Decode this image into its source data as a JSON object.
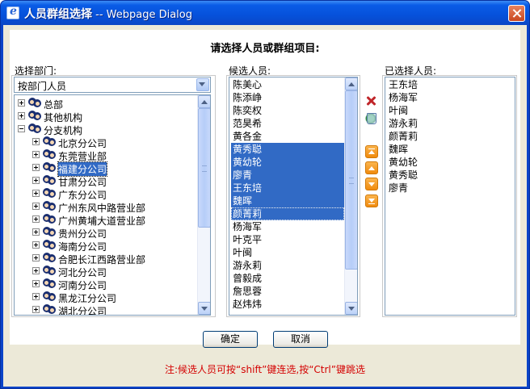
{
  "window": {
    "title": "人员群组选择",
    "subtitle": " -- Webpage Dialog"
  },
  "heading": "请选择人员或群组项目:",
  "columns": {
    "department_label": "选择部门:",
    "candidate_label": "候选人员:",
    "selected_label": "已选择人员:"
  },
  "department_select": {
    "value": "按部门人员"
  },
  "tree": [
    {
      "label": "总部",
      "expander": "plus",
      "level": 0,
      "selected": false
    },
    {
      "label": "其他机构",
      "expander": "plus",
      "level": 0,
      "selected": false
    },
    {
      "label": "分支机构",
      "expander": "minus",
      "level": 0,
      "selected": false
    },
    {
      "label": "北京分公司",
      "expander": "plus",
      "level": 1,
      "selected": false
    },
    {
      "label": "东莞营业部",
      "expander": "plus",
      "level": 1,
      "selected": false
    },
    {
      "label": "福建分公司",
      "expander": "plus",
      "level": 1,
      "selected": true
    },
    {
      "label": "甘肃分公司",
      "expander": "plus",
      "level": 1,
      "selected": false
    },
    {
      "label": "广东分公司",
      "expander": "plus",
      "level": 1,
      "selected": false
    },
    {
      "label": "广州东风中路营业部",
      "expander": "plus",
      "level": 1,
      "selected": false
    },
    {
      "label": "广州黄埔大道营业部",
      "expander": "plus",
      "level": 1,
      "selected": false
    },
    {
      "label": "贵州分公司",
      "expander": "plus",
      "level": 1,
      "selected": false
    },
    {
      "label": "海南分公司",
      "expander": "plus",
      "level": 1,
      "selected": false
    },
    {
      "label": "合肥长江西路营业部",
      "expander": "plus",
      "level": 1,
      "selected": false
    },
    {
      "label": "河北分公司",
      "expander": "plus",
      "level": 1,
      "selected": false
    },
    {
      "label": "河南分公司",
      "expander": "plus",
      "level": 1,
      "selected": false
    },
    {
      "label": "黑龙江分公司",
      "expander": "plus",
      "level": 1,
      "selected": false
    },
    {
      "label": "湖北分公司",
      "expander": "plus",
      "level": 1,
      "selected": false
    }
  ],
  "candidates": [
    {
      "name": "陈美心",
      "selected": false
    },
    {
      "name": "陈添峥",
      "selected": false
    },
    {
      "name": "陈奕权",
      "selected": false
    },
    {
      "name": "范昊希",
      "selected": false
    },
    {
      "name": "黄各金",
      "selected": false
    },
    {
      "name": "黄秀聪",
      "selected": true
    },
    {
      "name": "黄幼轮",
      "selected": true
    },
    {
      "name": "廖青",
      "selected": true
    },
    {
      "name": "王东培",
      "selected": true
    },
    {
      "name": "魏晖",
      "selected": true
    },
    {
      "name": "颜菁莉",
      "selected": true
    },
    {
      "name": "杨海军",
      "selected": false
    },
    {
      "name": "叶克平",
      "selected": false
    },
    {
      "name": "叶闽",
      "selected": false
    },
    {
      "name": "游永莉",
      "selected": false
    },
    {
      "name": "曾毅成",
      "selected": false
    },
    {
      "name": "詹思蓉",
      "selected": false
    },
    {
      "name": "赵炜炜",
      "selected": false
    }
  ],
  "selected_people": [
    "王东培",
    "杨海军",
    "叶闽",
    "游永莉",
    "颜菁莉",
    "魏晖",
    "黄幼轮",
    "黄秀聪",
    "廖青"
  ],
  "buttons": {
    "ok": "确定",
    "cancel": "取消"
  },
  "note": "注:候选人员可按“shift”键连选,按“Ctrl”键跳选",
  "icons": {
    "title": "ie-page-icon",
    "close": "close-icon",
    "remove": "delete-icon",
    "remove_all": "recycle-icon",
    "move_top": "move-top-icon",
    "move_up": "move-up-icon",
    "move_down": "move-down-icon",
    "move_bottom": "move-bottom-icon"
  },
  "colors": {
    "selection": "#316ac5",
    "note": "#d40000",
    "titlebar": "#0a5ce6"
  }
}
